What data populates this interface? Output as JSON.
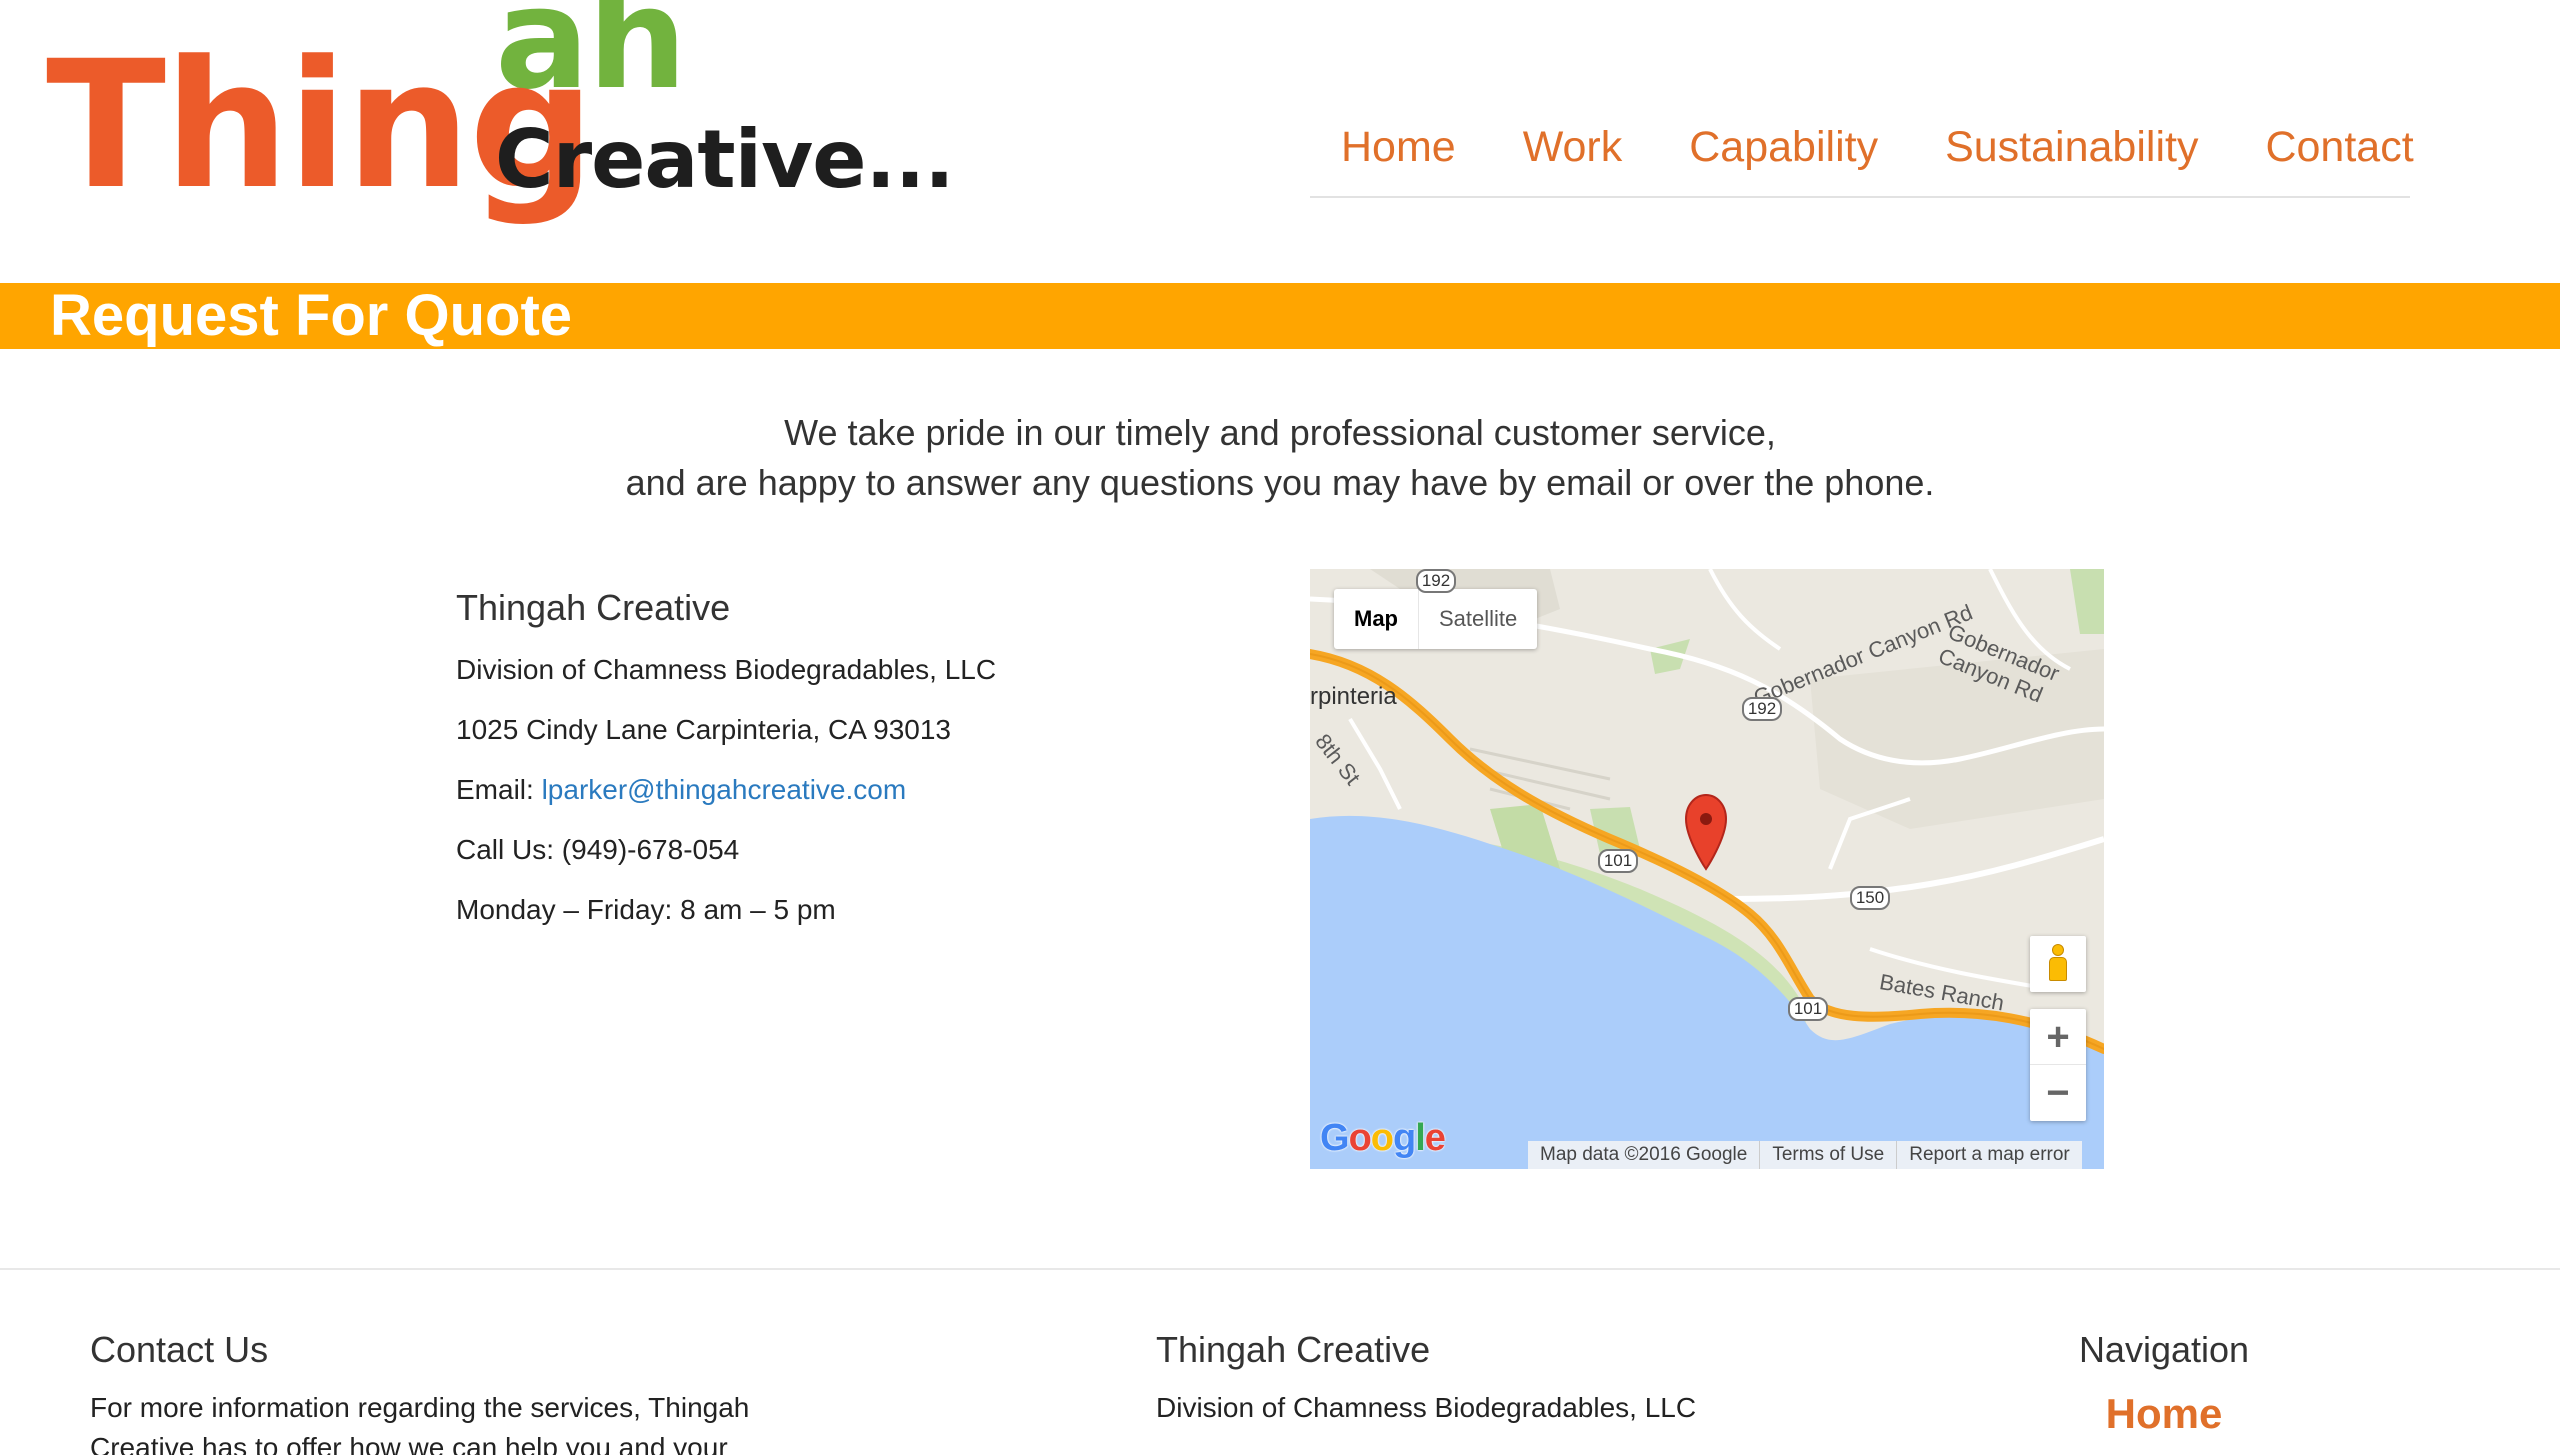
{
  "header": {
    "logo": {
      "part1": "Thing",
      "part2": "ah",
      "part3": "Creative..."
    },
    "nav": [
      "Home",
      "Work",
      "Capability",
      "Sustainability",
      "Contact"
    ]
  },
  "page_title": "Request For Quote",
  "intro": {
    "line1": "We take pride in our timely and professional customer service,",
    "line2": "and are happy to answer any questions you may have by email or over the phone."
  },
  "contact": {
    "company": "Thingah Creative",
    "division": "Division of Chamness Biodegradables, LLC",
    "address": "1025 Cindy Lane Carpinteria, CA 93013",
    "email_label": "Email:",
    "email": "lparker@thingahcreative.com",
    "phone": "Call Us: (949)-678-054",
    "hours": "Monday – Friday: 8 am – 5 pm"
  },
  "map": {
    "type_map": "Map",
    "type_satellite": "Satellite",
    "labels": {
      "city": "rpinteria",
      "street_8th": "8th St",
      "gobernador1": "Gobernador Canyon Rd",
      "gobernador2": "Gobernador Canyon Rd",
      "bates": "Bates Ranch"
    },
    "shields": {
      "s192a": "192",
      "s192b": "192",
      "s101a": "101",
      "s101b": "101",
      "s150": "150"
    },
    "zoom_in": "+",
    "zoom_out": "−",
    "google": [
      "G",
      "o",
      "o",
      "g",
      "l",
      "e"
    ],
    "attribution": [
      "Map data ©2016 Google",
      "Terms of Use",
      "Report a map error"
    ],
    "colors": {
      "water": "#abcdfa",
      "land": "#ebe8e0",
      "highway": "#f6a623",
      "marker": "#e8412b"
    }
  },
  "footer": {
    "contact_title": "Contact Us",
    "contact_text": "For more information regarding the services, Thingah Creative has to offer how we can help you and your",
    "company_title": "Thingah Creative",
    "company_text": "Division of Chamness Biodegradables, LLC",
    "nav_title": "Navigation",
    "nav_home": "Home"
  },
  "colors": {
    "accent_orange": "#ffa500",
    "nav_link": "#e0702a",
    "logo_orange": "#ec5b2a",
    "logo_green": "#72b33e",
    "link_blue": "#2a7abf"
  }
}
